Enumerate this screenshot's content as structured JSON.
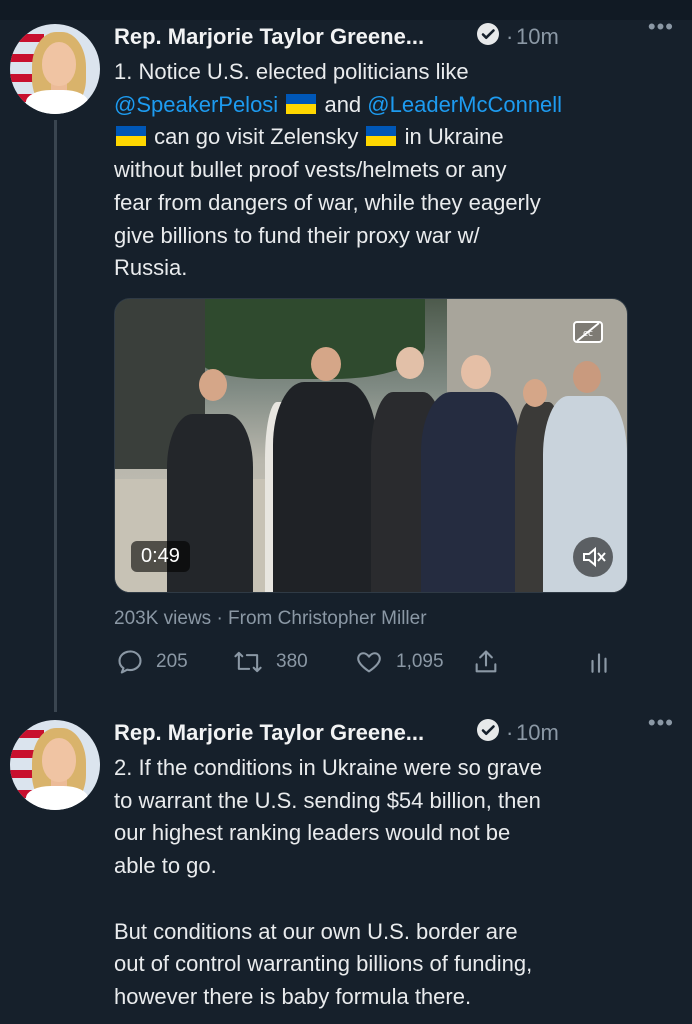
{
  "tweet1": {
    "name": "Rep. Marjorie Taylor Greene...",
    "separator": "·",
    "time": "10m",
    "more": "•••",
    "text": {
      "l1": "1. Notice U.S. elected politicians like",
      "l2_mention1": "@SpeakerPelosi",
      "l2_and": "and",
      "l2_mention2": "@LeaderMcConnell",
      "l3_a": "can go visit Zelensky",
      "l3_b": "in Ukraine",
      "l4": "without bullet proof vests/helmets or any",
      "l5": "fear from dangers of war, while they eagerly",
      "l6": "give billions to fund their proxy war w/",
      "l7": "Russia."
    },
    "media": {
      "duration": "0:49"
    },
    "views": "203K views · From Christopher Miller",
    "replies": "205",
    "retweets": "380",
    "likes": "1,095"
  },
  "tweet2": {
    "name": "Rep. Marjorie Taylor Greene...",
    "separator": "·",
    "time": "10m",
    "more": "•••",
    "text": {
      "l1": "2. If the conditions in Ukraine were so grave",
      "l2": "to warrant the U.S. sending $54 billion, then",
      "l3": "our highest ranking leaders would not be",
      "l4": "able to go.",
      "l5": "But conditions at our own U.S. border are",
      "l6": "out of control warranting billions of funding,",
      "l7": "however there is baby formula there."
    }
  },
  "colors": {
    "background": "#16202b",
    "link": "#1d9bf0",
    "muted": "#8b98a5"
  },
  "icons": [
    "verified-badge-icon",
    "ukraine-flag-icon",
    "closed-captions-icon",
    "mute-icon",
    "reply-icon",
    "retweet-icon",
    "like-icon",
    "share-icon",
    "analytics-icon"
  ]
}
